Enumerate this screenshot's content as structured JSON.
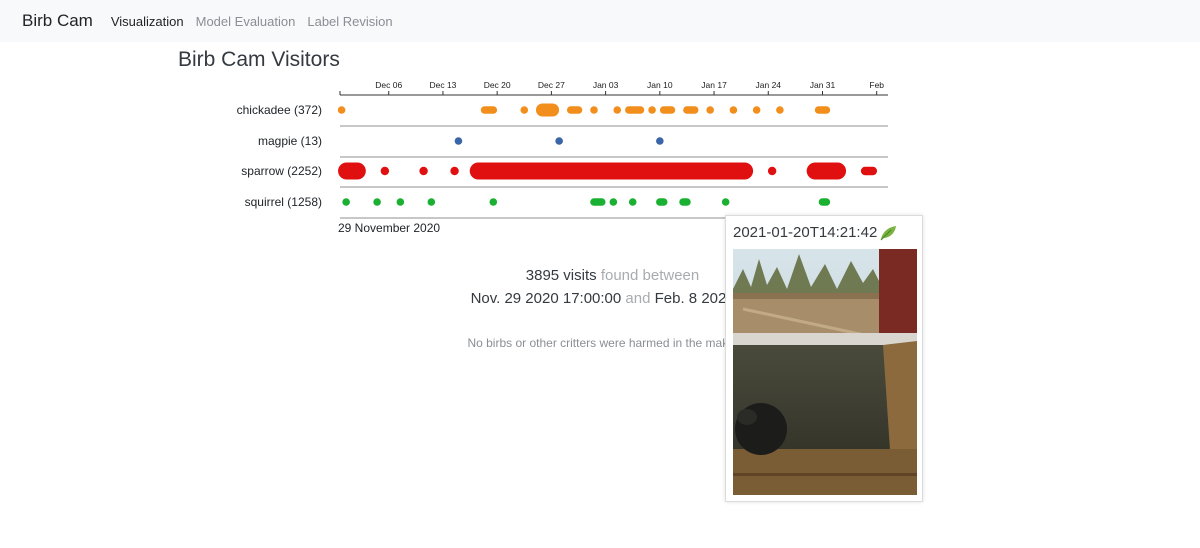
{
  "navbar": {
    "brand": "Birb Cam",
    "links": [
      {
        "label": "Visualization",
        "active": true
      },
      {
        "label": "Model Evaluation",
        "active": false
      },
      {
        "label": "Label Revision",
        "active": false
      }
    ]
  },
  "page_title": "Birb Cam Visitors",
  "chart_data": {
    "type": "scatter",
    "title": "",
    "x_axis": {
      "type": "date",
      "range": [
        "2020-11-29T17:00:00",
        "2021-02-08T11:00:00"
      ],
      "tick_labels": [
        "Dec 06",
        "Dec 13",
        "Dec 20",
        "Dec 27",
        "Jan 03",
        "Jan 10",
        "Jan 17",
        "Jan 24",
        "Jan 31",
        "Feb"
      ],
      "tick_dates": [
        "2020-12-06",
        "2020-12-13",
        "2020-12-20",
        "2020-12-27",
        "2021-01-03",
        "2021-01-10",
        "2021-01-17",
        "2021-01-24",
        "2021-01-31",
        "2021-02-07"
      ]
    },
    "start_label": "29 November 2020",
    "series": [
      {
        "name": "chickadee",
        "label": "chickadee (372)",
        "color": "#f28e1c",
        "clusters": [
          [
            "2020-11-29T22:00",
            "2020-11-29T22:00"
          ],
          [
            "2020-12-18T09:00",
            "2020-12-19T12:00"
          ],
          [
            "2020-12-23T12:00",
            "2020-12-23T12:00"
          ],
          [
            "2020-12-25T12:00",
            "2020-12-27T12:00"
          ],
          [
            "2020-12-29T12:00",
            "2020-12-30T12:00"
          ],
          [
            "2021-01-01T12:00",
            "2021-01-01T12:00"
          ],
          [
            "2021-01-04T12:00",
            "2021-01-04T12:00"
          ],
          [
            "2021-01-06T00:00",
            "2021-01-07T12:00"
          ],
          [
            "2021-01-09T00:00",
            "2021-01-09T00:00"
          ],
          [
            "2021-01-10T12:00",
            "2021-01-11T12:00"
          ],
          [
            "2021-01-13T12:00",
            "2021-01-14T12:00"
          ],
          [
            "2021-01-16T12:00",
            "2021-01-16T12:00"
          ],
          [
            "2021-01-19T12:00",
            "2021-01-19T12:00"
          ],
          [
            "2021-01-22T12:00",
            "2021-01-22T12:00"
          ],
          [
            "2021-01-25T12:00",
            "2021-01-25T12:00"
          ],
          [
            "2021-01-30T12:00",
            "2021-01-31T12:00"
          ]
        ]
      },
      {
        "name": "magpie",
        "label": "magpie (13)",
        "color": "#3a66a8",
        "clusters": [
          [
            "2020-12-15T00:00",
            "2020-12-15T00:00"
          ],
          [
            "2020-12-28T00:00",
            "2020-12-28T00:00"
          ],
          [
            "2021-01-10T00:00",
            "2021-01-10T00:00"
          ]
        ]
      },
      {
        "name": "sparrow",
        "label": "sparrow (2252)",
        "color": "#e01010",
        "clusters": [
          [
            "2020-11-30T00:00",
            "2020-12-02T12:00"
          ],
          [
            "2020-12-05T12:00",
            "2020-12-05T12:00"
          ],
          [
            "2020-12-10T12:00",
            "2020-12-10T12:00"
          ],
          [
            "2020-12-14T12:00",
            "2020-12-14T12:00"
          ],
          [
            "2020-12-17T00:00",
            "2021-01-21T12:00"
          ],
          [
            "2021-01-24T12:00",
            "2021-01-24T12:00"
          ],
          [
            "2021-01-29T12:00",
            "2021-02-02T12:00"
          ],
          [
            "2021-02-05T12:00",
            "2021-02-06T12:00"
          ]
        ]
      },
      {
        "name": "squirrel",
        "label": "squirrel (1258)",
        "color": "#1ab032",
        "clusters": [
          [
            "2020-11-30T12:00",
            "2020-11-30T12:00"
          ],
          [
            "2020-12-04T12:00",
            "2020-12-04T12:00"
          ],
          [
            "2020-12-07T12:00",
            "2020-12-07T12:00"
          ],
          [
            "2020-12-11T12:00",
            "2020-12-11T12:00"
          ],
          [
            "2020-12-19T12:00",
            "2020-12-19T12:00"
          ],
          [
            "2021-01-01T12:00",
            "2021-01-02T12:00"
          ],
          [
            "2021-01-04T00:00",
            "2021-01-04T00:00"
          ],
          [
            "2021-01-06T12:00",
            "2021-01-06T12:00"
          ],
          [
            "2021-01-10T00:00",
            "2021-01-10T12:00"
          ],
          [
            "2021-01-13T00:00",
            "2021-01-13T12:00"
          ],
          [
            "2021-01-18T12:00",
            "2021-01-18T12:00"
          ],
          [
            "2021-01-31T00:00",
            "2021-01-31T12:00"
          ]
        ]
      }
    ],
    "grid": false,
    "legend": "row labels at left"
  },
  "summary": {
    "count": "3895 visits",
    "found_between": "found between",
    "start": "Nov. 29 2020 17:00:00",
    "and": "and",
    "end": "Feb. 8 2021 11",
    "disclaimer": "No birbs or other critters were harmed in the making of"
  },
  "popup": {
    "timestamp": "2021-01-20T14:21:42",
    "icon": "leaf-icon",
    "icon_color": "#7bb241"
  }
}
